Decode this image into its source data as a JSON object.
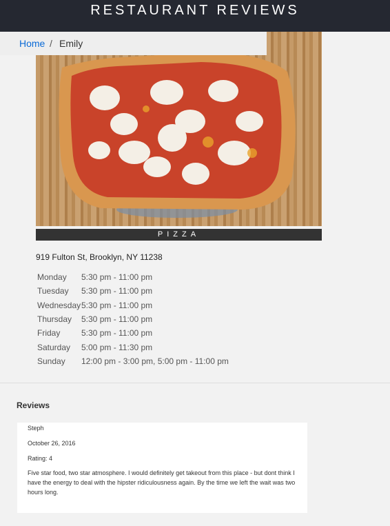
{
  "header": {
    "title": "RESTAURANT REVIEWS"
  },
  "breadcrumb": {
    "home": "Home",
    "separator": "/",
    "current": "Emily"
  },
  "restaurant": {
    "image_alt": "pizza",
    "cuisine": "PIZZA",
    "address": "919 Fulton St, Brooklyn, NY 11238",
    "hours": [
      {
        "day": "Monday",
        "time": "5:30 pm - 11:00 pm"
      },
      {
        "day": "Tuesday",
        "time": "5:30 pm - 11:00 pm"
      },
      {
        "day": "Wednesday",
        "time": "5:30 pm - 11:00 pm"
      },
      {
        "day": "Thursday",
        "time": "5:30 pm - 11:00 pm"
      },
      {
        "day": "Friday",
        "time": "5:30 pm - 11:00 pm"
      },
      {
        "day": "Saturday",
        "time": "5:00 pm - 11:30 pm"
      },
      {
        "day": "Sunday",
        "time": "12:00 pm - 3:00 pm, 5:00 pm - 11:00 pm"
      }
    ]
  },
  "reviews": {
    "title": "Reviews",
    "items": [
      {
        "name": "Steph",
        "date": "October 26, 2016",
        "rating": "Rating: 4",
        "comments": "Five star food, two star atmosphere. I would definitely get takeout from this place - but dont think I have the energy to deal with the hipster ridiculousness again. By the time we left the wait was two hours long."
      }
    ]
  }
}
